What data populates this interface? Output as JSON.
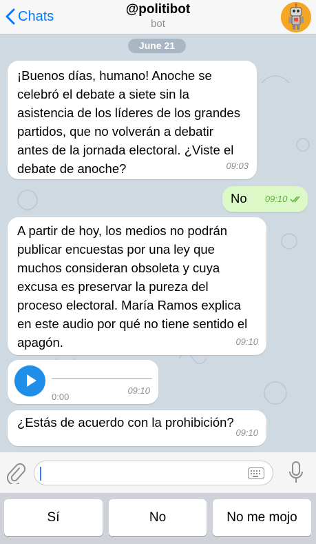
{
  "header": {
    "back_label": "Chats",
    "title": "@politibot",
    "subtitle": "bot"
  },
  "chat": {
    "date": "June 21",
    "messages": [
      {
        "direction": "in",
        "text": "¡Buenos días, humano! Anoche se celebró el debate a siete sin la asistencia de los líderes de los grandes partidos, que no volverán a debatir antes de la jornada electoral. ¿Viste el debate de anoche?",
        "time": "09:03"
      },
      {
        "direction": "out",
        "text": "No",
        "time": "09:10",
        "status": "read"
      },
      {
        "direction": "in",
        "text": "A partir de hoy, los medios no podrán publicar encuestas por una ley que muchos consideran obsoleta y cuya excusa es preservar la pureza del proceso electoral. María Ramos explica en este audio por qué no tiene sentido el apagón.",
        "time": "09:10"
      },
      {
        "direction": "in",
        "type": "audio",
        "duration": "0:00",
        "progress": 0,
        "time": "09:10"
      },
      {
        "direction": "in",
        "text": "¿Estás de acuerdo con la prohibición?",
        "time": "09:10"
      }
    ]
  },
  "input": {
    "placeholder": "",
    "icons": [
      "paperclip-icon",
      "keyboard-icon",
      "microphone-icon"
    ]
  },
  "reply_keyboard": {
    "buttons": [
      "Sí",
      "No",
      "No me mojo"
    ]
  },
  "colors": {
    "accent": "#007aff",
    "outgoing_bubble": "#dcf8c6",
    "read_ticks": "#5bb03b",
    "play_button": "#1e8ee8",
    "date_pill": "#a9b6c3"
  }
}
